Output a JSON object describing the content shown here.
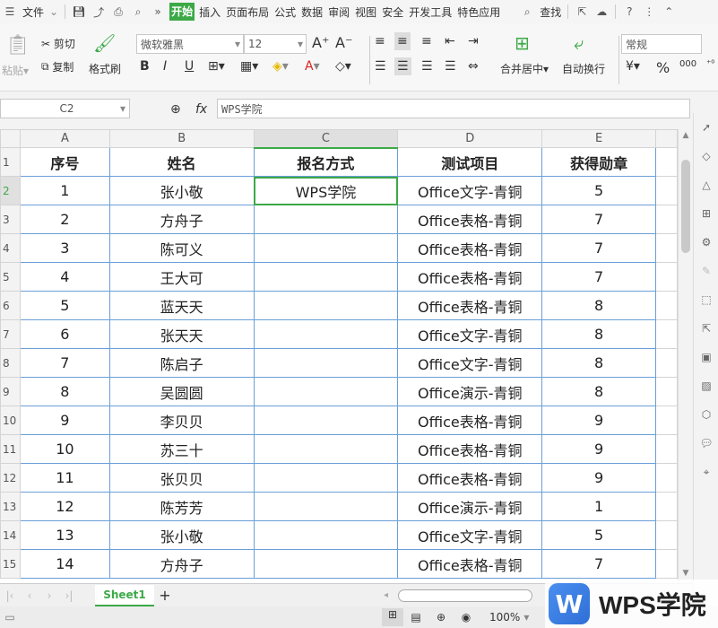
{
  "menubar": {
    "file": "文件",
    "tabs": [
      "开始",
      "插入",
      "页面布局",
      "公式",
      "数据",
      "审阅",
      "视图",
      "安全",
      "开发工具",
      "特色应用"
    ],
    "active_tab": "开始",
    "search": "查找"
  },
  "ribbon": {
    "paste": "粘贴",
    "cut": "剪切",
    "copy": "复制",
    "format_painter": "格式刷",
    "font_name": "微软雅黑",
    "font_size": "12",
    "merge_center": "合并居中",
    "wrap_text": "自动换行",
    "number_format": "常规"
  },
  "formula": {
    "cell_ref": "C2",
    "fx": "fx",
    "content": "WPS学院"
  },
  "grid": {
    "columns": [
      "A",
      "B",
      "C",
      "D",
      "E"
    ],
    "header_row": [
      "序号",
      "姓名",
      "报名方式",
      "测试项目",
      "获得勋章"
    ],
    "rows": [
      [
        "1",
        "张小敬",
        "WPS学院",
        "Office文字-青铜",
        "5"
      ],
      [
        "2",
        "方舟子",
        "",
        "Office表格-青铜",
        "7"
      ],
      [
        "3",
        "陈可义",
        "",
        "Office表格-青铜",
        "7"
      ],
      [
        "4",
        "王大可",
        "",
        "Office表格-青铜",
        "7"
      ],
      [
        "5",
        "蓝天天",
        "",
        "Office表格-青铜",
        "8"
      ],
      [
        "6",
        "张天天",
        "",
        "Office文字-青铜",
        "8"
      ],
      [
        "7",
        "陈启子",
        "",
        "Office文字-青铜",
        "8"
      ],
      [
        "8",
        "吴圆圆",
        "",
        "Office演示-青铜",
        "8"
      ],
      [
        "9",
        "李贝贝",
        "",
        "Office表格-青铜",
        "9"
      ],
      [
        "10",
        "苏三十",
        "",
        "Office表格-青铜",
        "9"
      ],
      [
        "11",
        "张贝贝",
        "",
        "Office表格-青铜",
        "9"
      ],
      [
        "12",
        "陈芳芳",
        "",
        "Office演示-青铜",
        "1"
      ],
      [
        "13",
        "张小敬",
        "",
        "Office文字-青铜",
        "5"
      ],
      [
        "14",
        "方舟子",
        "",
        "Office表格-青铜",
        "7"
      ]
    ],
    "row_numbers": [
      "1",
      "2",
      "3",
      "4",
      "5",
      "6",
      "7",
      "8",
      "9",
      "10",
      "11",
      "12",
      "13",
      "14",
      "15"
    ]
  },
  "sheetbar": {
    "sheet": "Sheet1",
    "add": "+"
  },
  "status": {
    "zoom": "100%"
  },
  "watermark": {
    "text": "WPS学院"
  },
  "colors": {
    "accent": "#3ca947",
    "cell_border": "#6a9fd8",
    "brand_blue": "#2f6fd6"
  }
}
